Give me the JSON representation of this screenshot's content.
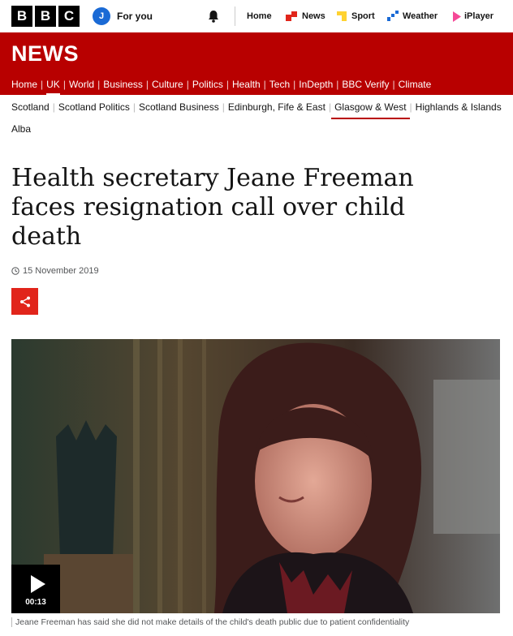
{
  "brand": {
    "letters": [
      "B",
      "B",
      "C"
    ]
  },
  "account": {
    "initial": "J",
    "label": "For you"
  },
  "topnav": [
    {
      "label": "Home",
      "icon": "home"
    },
    {
      "label": "News",
      "icon": "news-icon",
      "color": "#e1251b"
    },
    {
      "label": "Sport",
      "icon": "sport-icon",
      "color": "#ffd230"
    },
    {
      "label": "Weather",
      "icon": "weather-icon",
      "color": "#1a6ad5"
    },
    {
      "label": "iPlayer",
      "icon": "iplayer-icon",
      "color": "#f54997"
    }
  ],
  "banner": {
    "title": "NEWS"
  },
  "mainnav": [
    "Home",
    "UK",
    "World",
    "Business",
    "Culture",
    "Politics",
    "Health",
    "Tech",
    "InDepth",
    "BBC Verify",
    "Climate"
  ],
  "mainnav_active": "UK",
  "subnav": [
    "Scotland",
    "Scotland Politics",
    "Scotland Business",
    "Edinburgh, Fife & East",
    "Glasgow & West",
    "Highlands & Islands"
  ],
  "subnav_selected": "Glasgow & West",
  "subnav_extra": "Alba",
  "article": {
    "headline": "Health secretary Jeane Freeman faces resignation call over child death",
    "date": "15 November 2019",
    "video_duration": "00:13",
    "caption": "Jeane Freeman has said she did not make details of the child's death public due to patient confidentiality"
  },
  "colors": {
    "brand_red": "#b80000",
    "share_red": "#e1251b"
  }
}
